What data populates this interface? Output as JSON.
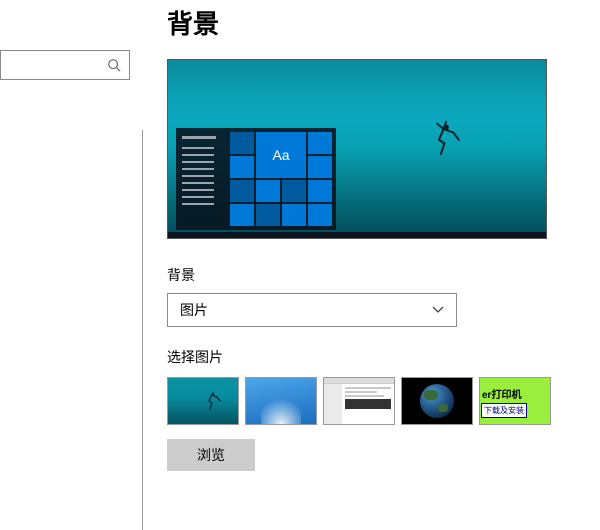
{
  "search": {
    "placeholder": ""
  },
  "page_title": "背景",
  "preview": {
    "tile_text": "Aa"
  },
  "background_section": {
    "label": "背景",
    "dropdown_value": "图片"
  },
  "choose_picture": {
    "label": "选择图片",
    "thumbs": [
      {
        "name": "underwater"
      },
      {
        "name": "windows-light"
      },
      {
        "name": "document"
      },
      {
        "name": "earth"
      },
      {
        "name": "printer-ad",
        "line1": "er打印机",
        "line2": "下载及安装"
      }
    ]
  },
  "browse_label": "浏览"
}
